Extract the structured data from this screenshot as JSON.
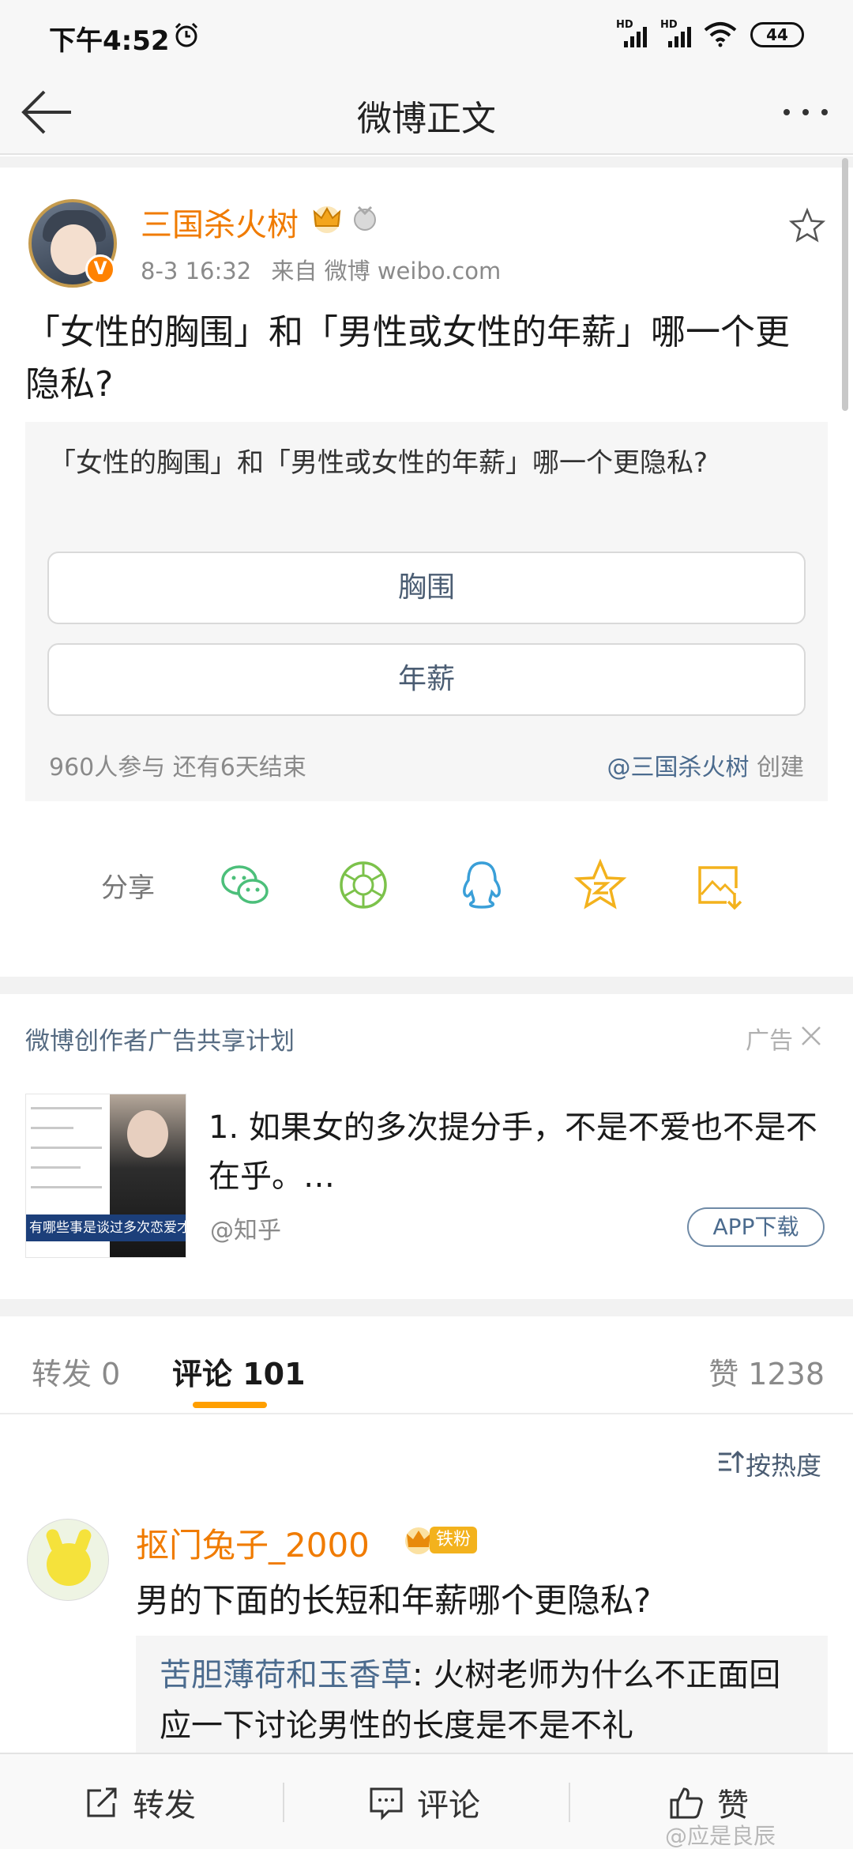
{
  "status_bar": {
    "time": "下午4:52",
    "battery": "44",
    "network": [
      "HD",
      "HD"
    ]
  },
  "nav": {
    "title": "微博正文"
  },
  "post": {
    "author": "三国杀火树",
    "time": "8-3 16:32",
    "source": "来自 微博 weibo.com",
    "text": "「女性的胸围」和「男性或女性的年薪」哪一个更隐私?"
  },
  "poll": {
    "question": "「女性的胸围」和「男性或女性的年薪」哪一个更隐私?",
    "options": [
      "胸围",
      "年薪"
    ],
    "stats": "960人参与  还有6天结束",
    "creator_link": "@三国杀火树",
    "creator_suffix": " 创建"
  },
  "share": {
    "label": "分享",
    "icons": [
      "wechat-icon",
      "moments-icon",
      "qq-icon",
      "qzone-icon",
      "save-image-icon"
    ]
  },
  "ad": {
    "title": "微博创作者广告共享计划",
    "label": "广告",
    "text": "1. 如果女的多次提分手，不是不爱也不是不在乎。…",
    "source": "@知乎",
    "button": "APP下载",
    "thumb_caption": "有哪些事是谈过多次恋爱才明"
  },
  "tabs": {
    "reposts": "转发 0",
    "comments": "评论 101",
    "likes": "赞 1238"
  },
  "sort": {
    "label": "按热度"
  },
  "comment": {
    "user": "抠门兔子_2000",
    "badge": "铁粉",
    "text": "男的下面的长短和年薪哪个更隐私?",
    "reply_user": "苦胆薄荷和玉香草",
    "reply_text": ": 火树老师为什么不正面回应一下讨论男性的长度是不是不礼"
  },
  "bottom_bar": {
    "repost": "转发",
    "comment": "评论",
    "like": "赞"
  },
  "watermark": "@应是良辰",
  "colors": {
    "author_orange": "#f07b00",
    "link_blue": "#4b6b8e",
    "tab_accent": "#ff9f00"
  }
}
